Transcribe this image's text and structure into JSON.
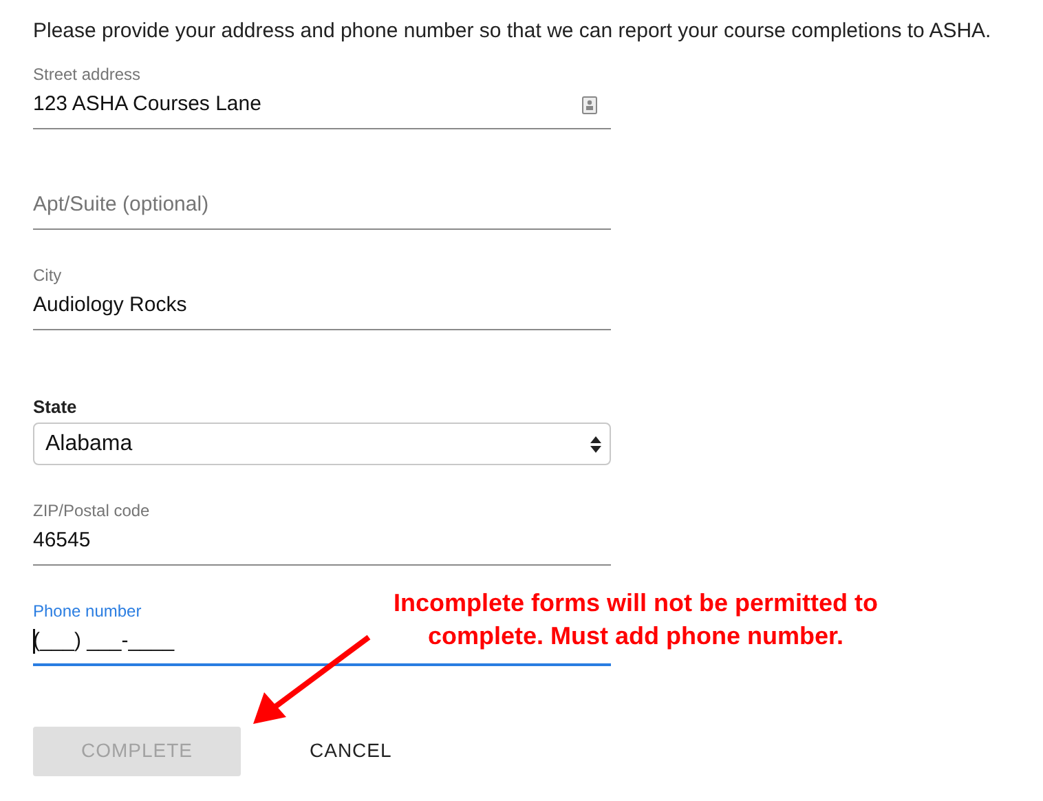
{
  "intro": "Please provide your address and phone number so that we can report your course completions to ASHA.",
  "fields": [
    {
      "kind": "text",
      "label": "Street address",
      "value": "123 ASHA Courses Lane",
      "focused": false,
      "autofill_icon": true
    },
    {
      "kind": "text",
      "placeholder": "Apt/Suite (optional)",
      "focused": false
    },
    {
      "kind": "text",
      "label": "City",
      "value": "Audiology Rocks",
      "focused": false
    },
    {
      "kind": "select",
      "label": "State",
      "value": "Alabama"
    },
    {
      "kind": "text",
      "label": "ZIP/Postal code",
      "value": "46545",
      "focused": false
    },
    {
      "kind": "text",
      "label": "Phone number",
      "value": "(___) ___-____",
      "focused": true
    }
  ],
  "buttons": [
    {
      "label": "COMPLETE",
      "disabled": true
    },
    {
      "label": "CANCEL",
      "disabled": false
    }
  ],
  "annotation": {
    "text": "Incomplete forms will not be permitted to complete. Must add phone number."
  }
}
